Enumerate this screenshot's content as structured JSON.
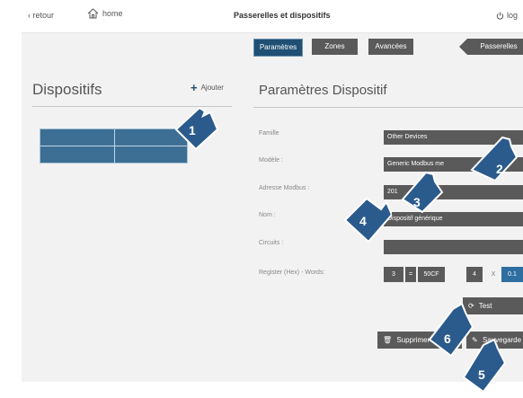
{
  "topbar": {
    "back_label": "retour",
    "home_label": "home",
    "title": "Passerelles et dispositifs",
    "logout_label": "log"
  },
  "tabs": {
    "params": "Paramètres",
    "zones": "Zones",
    "advanced": "Avancées",
    "gateways": "Passerelles"
  },
  "left": {
    "title": "Dispositifs",
    "add_label": "Ajouter"
  },
  "form": {
    "title": "Paramètres Dispositif",
    "labels": {
      "family": "Famille",
      "model": "Modèle :",
      "address": "Adresse Modbus :",
      "name": "Nom :",
      "circuits": "Circuits :",
      "register": "Register (Hex) - Words:"
    },
    "values": {
      "family": "Other Devices",
      "model": "Generic Modbus me",
      "address": "201",
      "name": "Dispositif générique",
      "circuits": ""
    },
    "register": {
      "count": "3",
      "equals": "=",
      "hex": "50CF",
      "words": "4",
      "times": "X",
      "factor": "0.1"
    },
    "buttons": {
      "test": "Test",
      "delete": "Supprimer",
      "save": "Sauvegarde"
    }
  },
  "callouts": [
    "1",
    "2",
    "3",
    "4",
    "5",
    "6"
  ],
  "colors": {
    "accent": "#1f4f73",
    "field": "#5a5a5a",
    "callout": "#2b5a8c"
  }
}
